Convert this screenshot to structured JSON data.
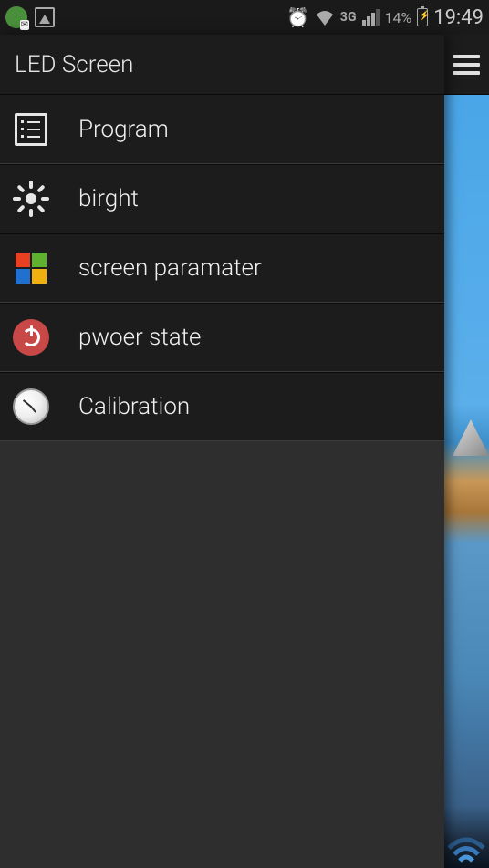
{
  "status": {
    "network_type": "3G",
    "battery_percent": "14%",
    "time": "19:49"
  },
  "drawer": {
    "title": "LED Screen",
    "items": [
      {
        "label": "Program"
      },
      {
        "label": "birght"
      },
      {
        "label": "screen paramater"
      },
      {
        "label": "pwoer state"
      },
      {
        "label": "Calibration"
      }
    ]
  }
}
